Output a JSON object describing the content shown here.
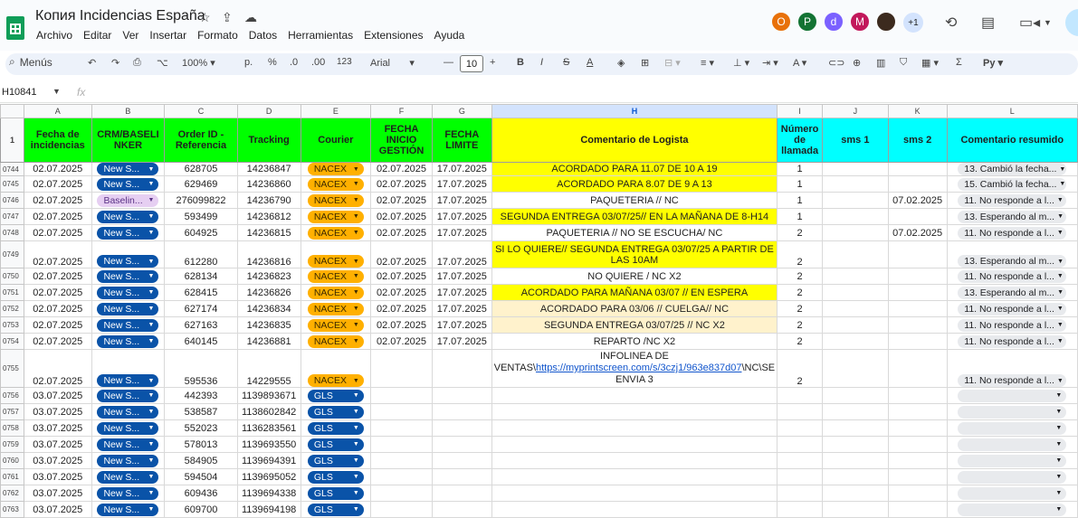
{
  "doc": {
    "title": "Копия Incidencias España"
  },
  "menu": [
    "Archivo",
    "Editar",
    "Ver",
    "Insertar",
    "Formato",
    "Datos",
    "Herramientas",
    "Extensiones",
    "Ayuda"
  ],
  "avatars": [
    {
      "letter": "O",
      "color": "#e8710a"
    },
    {
      "letter": "P",
      "color": "#137333"
    },
    {
      "letter": "d",
      "color": "#7b61ff"
    },
    {
      "letter": "M",
      "color": "#c2185b"
    },
    {
      "letter": "",
      "color": "#3c2a1e"
    },
    {
      "letter": "+1",
      "color": "#d3e3fd"
    }
  ],
  "toolbar": {
    "search": "Menús",
    "zoom": "100%",
    "currency": "р.",
    "percent": "%",
    "dec_less": ".0",
    "dec_more": ".00",
    "number_fmt": "123",
    "font": "Arial",
    "font_size": "10",
    "py": "Рy"
  },
  "namebox": "H10841",
  "fx": "fx",
  "columns": [
    "A",
    "B",
    "C",
    "D",
    "E",
    "F",
    "G",
    "H",
    "I",
    "J",
    "K",
    "L"
  ],
  "header_rownum": "1",
  "headers": {
    "a": "Fecha de incidencias",
    "b": "CRM/BASELINKER",
    "c": "Order ID - Referencia",
    "d": "Tracking",
    "e": "Courier",
    "f": "FECHA INICIO GESTIÓN",
    "g": "FECHA LIMITE",
    "h": "Comentario de Logista",
    "i": "Número de llamada",
    "j": "sms 1",
    "k": "sms 2",
    "l": "Comentario resumido"
  },
  "rows": [
    {
      "n": "0744",
      "a": "02.07.2025",
      "b": "New S...",
      "c": "628705",
      "d": "14236847",
      "e": "NACEX",
      "f": "02.07.2025",
      "g": "17.07.2025",
      "h": "ACORDADO PARA 11.07 DE 10 A 19",
      "i": "1",
      "k": "",
      "l": "13. Cambió la fecha..."
    },
    {
      "n": "0745",
      "a": "02.07.2025",
      "b": "New S...",
      "c": "629469",
      "d": "14236860",
      "e": "NACEX",
      "f": "02.07.2025",
      "g": "17.07.2025",
      "h": "ACORDADO PARA 8.07 DE 9 A 13",
      "i": "1",
      "k": "",
      "l": "15. Cambió la fecha..."
    },
    {
      "n": "0746",
      "a": "02.07.2025",
      "b": "Baselin...",
      "c": "276099822",
      "d": "14236790",
      "e": "NACEX",
      "f": "02.07.2025",
      "g": "17.07.2025",
      "h": "PAQUETERIA // NC",
      "i": "1",
      "k": "07.02.2025",
      "l": "11. No responde a l..."
    },
    {
      "n": "0747",
      "a": "02.07.2025",
      "b": "New S...",
      "c": "593499",
      "d": "14236812",
      "e": "NACEX",
      "f": "02.07.2025",
      "g": "17.07.2025",
      "h": "SEGUNDA ENTREGA 03/07/25//  EN LA MAÑANA DE 8-H14",
      "i": "1",
      "k": "",
      "l": "13. Esperando al m..."
    },
    {
      "n": "0748",
      "a": "02.07.2025",
      "b": "New S...",
      "c": "604925",
      "d": "14236815",
      "e": "NACEX",
      "f": "02.07.2025",
      "g": "17.07.2025",
      "h": "PAQUETERIA // NO SE ESCUCHA/ NC",
      "i": "2",
      "k": "07.02.2025",
      "l": "11. No responde a l..."
    },
    {
      "n": "0749",
      "a": "02.07.2025",
      "b": "New S...",
      "c": "612280",
      "d": "14236816",
      "e": "NACEX",
      "f": "02.07.2025",
      "g": "17.07.2025",
      "h": "SI LO QUIERE// SEGUNDA ENTREGA 03/07/25 A PARTIR DE LAS 10AM",
      "i": "2",
      "k": "",
      "l": "13. Esperando al m..."
    },
    {
      "n": "0750",
      "a": "02.07.2025",
      "b": "New S...",
      "c": "628134",
      "d": "14236823",
      "e": "NACEX",
      "f": "02.07.2025",
      "g": "17.07.2025",
      "h": "NO QUIERE / NC X2",
      "i": "2",
      "k": "",
      "l": "11. No responde a l..."
    },
    {
      "n": "0751",
      "a": "02.07.2025",
      "b": "New S...",
      "c": "628415",
      "d": "14236826",
      "e": "NACEX",
      "f": "02.07.2025",
      "g": "17.07.2025",
      "h": "ACORDADO PARA MAÑANA 03/07 // EN ESPERA",
      "i": "2",
      "k": "",
      "l": "13. Esperando al m..."
    },
    {
      "n": "0752",
      "a": "02.07.2025",
      "b": "New S...",
      "c": "627174",
      "d": "14236834",
      "e": "NACEX",
      "f": "02.07.2025",
      "g": "17.07.2025",
      "h": "ACORDADO PARA 03/06 // CUELGA// NC",
      "i": "2",
      "k": "",
      "l": "11. No responde a l..."
    },
    {
      "n": "0753",
      "a": "02.07.2025",
      "b": "New S...",
      "c": "627163",
      "d": "14236835",
      "e": "NACEX",
      "f": "02.07.2025",
      "g": "17.07.2025",
      "h": "SEGUNDA ENTREGA  03/07/25 // NC X2",
      "i": "2",
      "k": "",
      "l": "11. No responde a l..."
    },
    {
      "n": "0754",
      "a": "02.07.2025",
      "b": "New S...",
      "c": "640145",
      "d": "14236881",
      "e": "NACEX",
      "f": "02.07.2025",
      "g": "17.07.2025",
      "h": "REPARTO /NC X2",
      "i": "2",
      "k": "",
      "l": "11. No responde a l..."
    },
    {
      "n": "0755",
      "a": "02.07.2025",
      "b": "New S...",
      "c": "595536",
      "d": "14229555",
      "e": "NACEX",
      "f": "",
      "g": "",
      "h1": "INFOLINEA DE VENTAS\\",
      "hlink": "https://myprintscreen.com/s/3czj1/963e837d07",
      "h2": "\\NC\\SE ENVIA 3",
      "i": "2",
      "k": "",
      "l": "11. No responde a l..."
    },
    {
      "n": "0756",
      "a": "03.07.2025",
      "b": "New S...",
      "c": "442393",
      "d": "1139893671",
      "e": "GLS"
    },
    {
      "n": "0757",
      "a": "03.07.2025",
      "b": "New S...",
      "c": "538587",
      "d": "1138602842",
      "e": "GLS"
    },
    {
      "n": "0758",
      "a": "03.07.2025",
      "b": "New S...",
      "c": "552023",
      "d": "1136283561",
      "e": "GLS"
    },
    {
      "n": "0759",
      "a": "03.07.2025",
      "b": "New S...",
      "c": "578013",
      "d": "1139693550",
      "e": "GLS"
    },
    {
      "n": "0760",
      "a": "03.07.2025",
      "b": "New S...",
      "c": "584905",
      "d": "1139694391",
      "e": "GLS"
    },
    {
      "n": "0761",
      "a": "03.07.2025",
      "b": "New S...",
      "c": "594504",
      "d": "1139695052",
      "e": "GLS"
    },
    {
      "n": "0762",
      "a": "03.07.2025",
      "b": "New S...",
      "c": "609436",
      "d": "1139694338",
      "e": "GLS"
    },
    {
      "n": "0763",
      "a": "03.07.2025",
      "b": "New S...",
      "c": "609700",
      "d": "1139694198",
      "e": "GLS"
    }
  ]
}
